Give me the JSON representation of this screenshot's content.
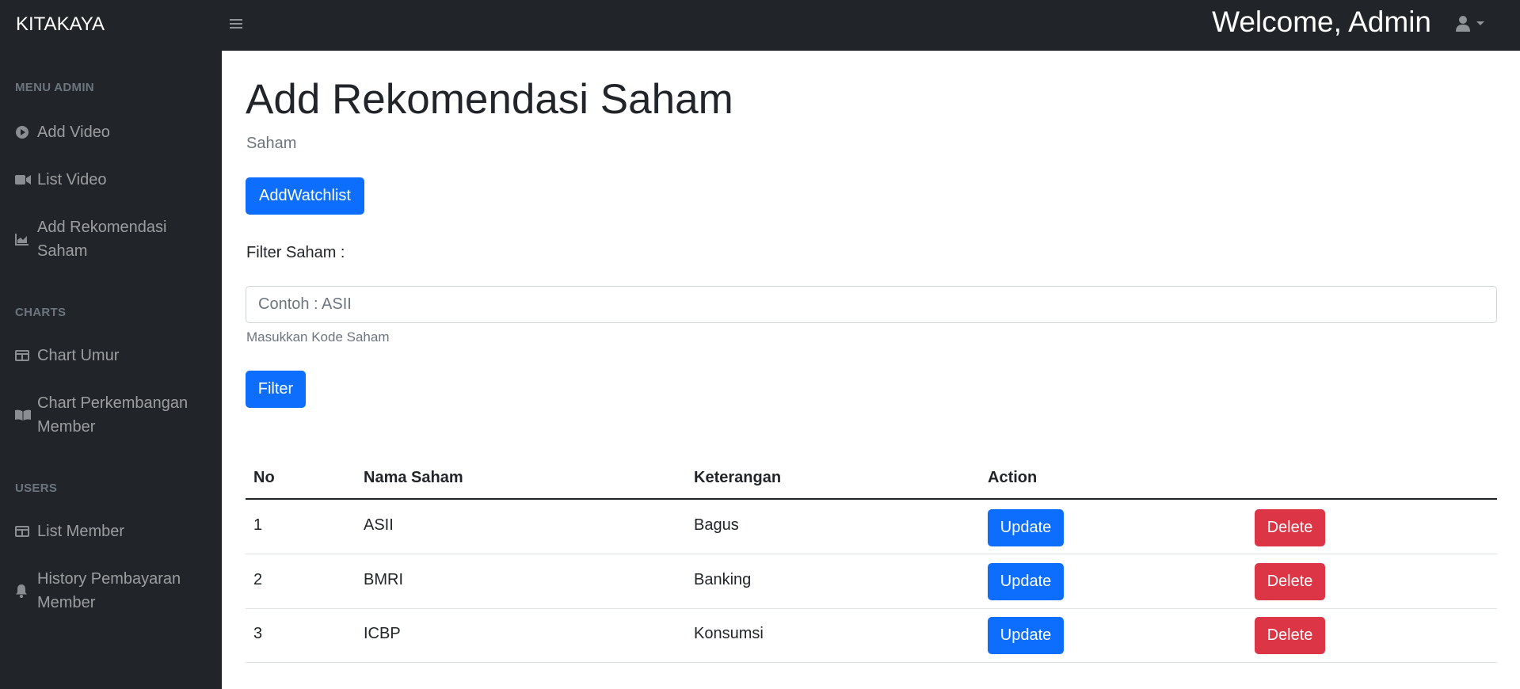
{
  "topbar": {
    "brand": "KITAKAYA",
    "welcome": "Welcome, Admin"
  },
  "sidebar": {
    "headings": [
      "MENU ADMIN",
      "CHARTS",
      "USERS"
    ],
    "items": [
      {
        "label": "Add Video",
        "icon": "play-circle-icon"
      },
      {
        "label": "List Video",
        "icon": "video-camera-icon"
      },
      {
        "label": "Add Rekomendasi Saham",
        "icon": "chart-area-icon"
      },
      {
        "label": "Chart Umur",
        "icon": "table-icon"
      },
      {
        "label": "Chart Perkembangan Member",
        "icon": "book-open-icon"
      },
      {
        "label": "List Member",
        "icon": "table-icon"
      },
      {
        "label": "History Pembayaran Member",
        "icon": "bell-icon"
      }
    ]
  },
  "main": {
    "title": "Add Rekomendasi Saham",
    "breadcrumb": "Saham",
    "add_button": "AddWatchlist",
    "filter_label": "Filter Saham :",
    "filter_placeholder": "Contoh : ASII",
    "filter_help": "Masukkan Kode Saham",
    "filter_button": "Filter"
  },
  "table": {
    "columns": [
      "No",
      "Nama Saham",
      "Keterangan",
      "Action"
    ],
    "rows": [
      {
        "no": "1",
        "nama": "ASII",
        "keterangan": "Bagus",
        "update": "Update",
        "delete": "Delete"
      },
      {
        "no": "2",
        "nama": "BMRI",
        "keterangan": "Banking",
        "update": "Update",
        "delete": "Delete"
      },
      {
        "no": "3",
        "nama": "ICBP",
        "keterangan": "Konsumsi",
        "update": "Update",
        "delete": "Delete"
      }
    ]
  },
  "colors": {
    "sidebar_bg": "#212529",
    "primary": "#0d6efd",
    "danger": "#dc3545"
  }
}
